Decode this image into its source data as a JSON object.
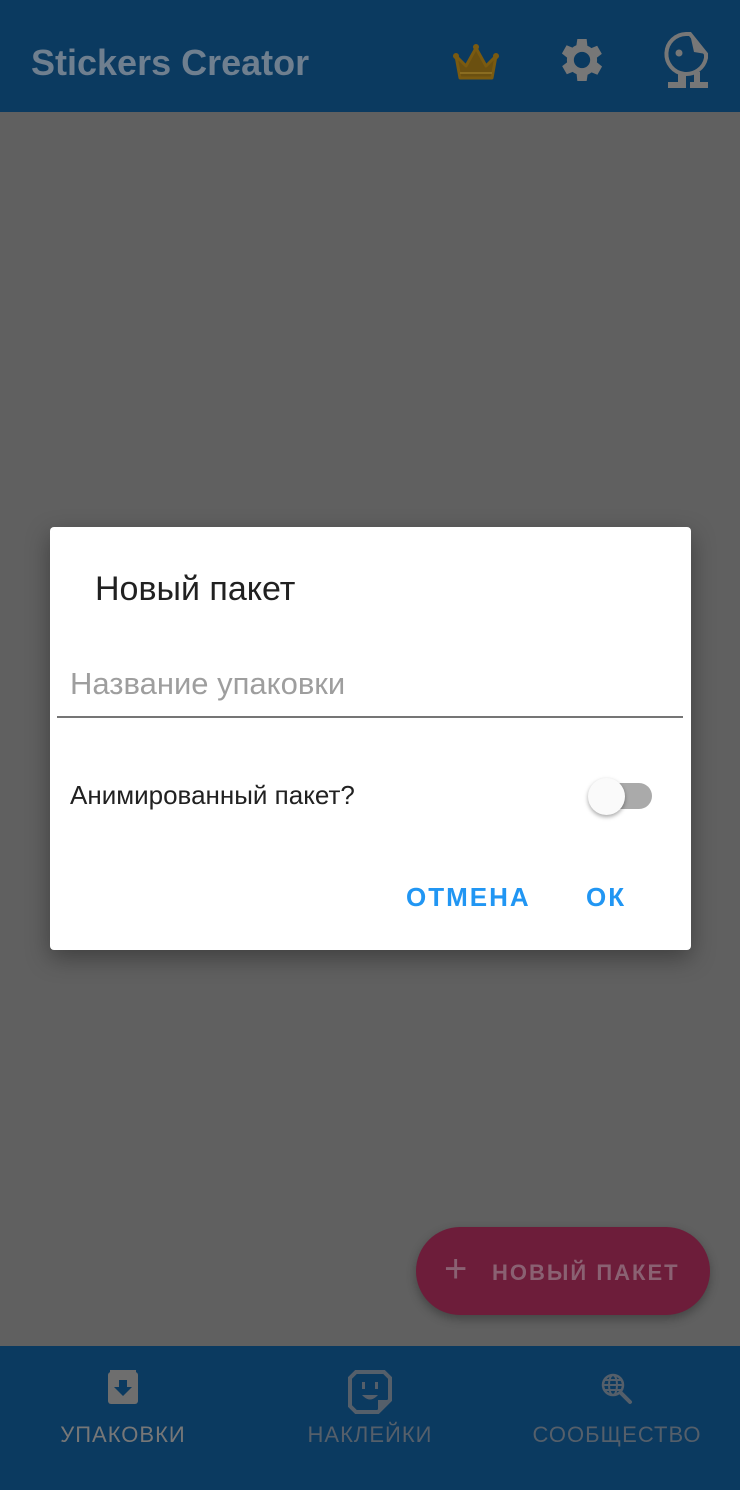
{
  "app": {
    "title": "Stickers Creator",
    "icons": [
      "crown-icon",
      "gear-icon",
      "sticker-mascot-icon"
    ]
  },
  "dialog": {
    "title": "Новый пакет",
    "input_placeholder": "Название упаковки",
    "input_value": "",
    "switch_label": "Анимированный пакет?",
    "switch_on": false,
    "cancel": "ОТМЕНА",
    "ok": "ОК"
  },
  "fab": {
    "label": "НОВЫЙ ПАКЕТ"
  },
  "nav": {
    "items": [
      {
        "label": "УПАКОВКИ",
        "icon": "pack-download-icon",
        "active": true
      },
      {
        "label": "НАКЛЕЙКИ",
        "icon": "sticker-face-icon",
        "active": false
      },
      {
        "label": "СООБЩЕСТВО",
        "icon": "globe-search-icon",
        "active": false
      }
    ]
  },
  "colors": {
    "primary": "#0b3a60",
    "accent": "#2196f3",
    "fab": "#6d1d3a",
    "crown": "#7a5a10"
  }
}
